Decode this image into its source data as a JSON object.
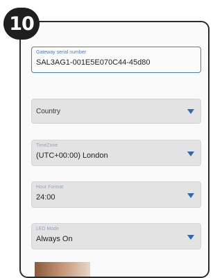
{
  "step": {
    "number": "10"
  },
  "serial": {
    "label": "Gateway serial number",
    "value": "SAL3AG1-001E5E070C44-45d80"
  },
  "country": {
    "placeholder": "Country"
  },
  "timezone": {
    "label": "TimeZone",
    "value": "(UTC+00:00) London"
  },
  "hour_format": {
    "label": "Hour Format",
    "value": "24:00"
  },
  "led_mode": {
    "label": "LED Mode",
    "value": "Always On"
  },
  "colors": {
    "accent": "#2e6ab3",
    "field_bg": "#e3e3e3",
    "badge": "#1f1f1f"
  },
  "icons": {
    "dropdown": "caret-down-icon"
  }
}
